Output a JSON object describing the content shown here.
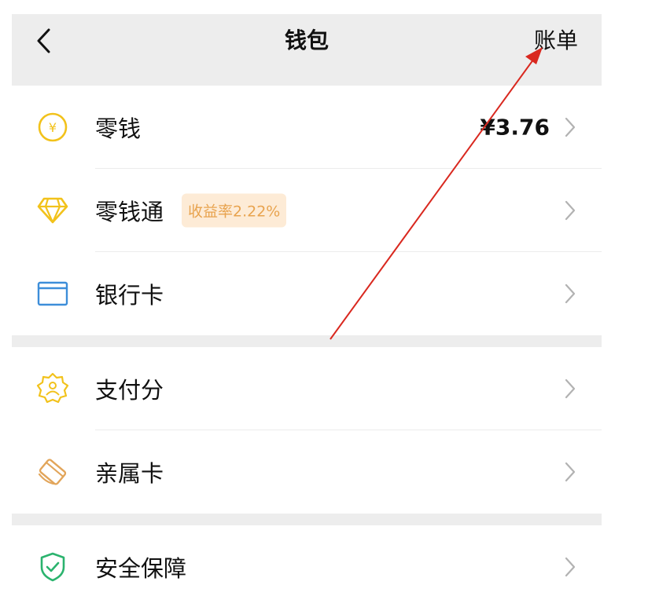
{
  "header": {
    "back_icon": "chevron-left-icon",
    "title": "钱包",
    "bill_label": "账单"
  },
  "groups": [
    {
      "items": [
        {
          "icon": "coin-yuan-icon",
          "label": "零钱",
          "value": "¥3.76"
        },
        {
          "icon": "diamond-icon",
          "label": "零钱通",
          "badge": "收益率2.22%"
        },
        {
          "icon": "bank-card-icon",
          "label": "银行卡"
        }
      ]
    },
    {
      "items": [
        {
          "icon": "pay-score-icon",
          "label": "支付分"
        },
        {
          "icon": "family-card-icon",
          "label": "亲属卡"
        }
      ]
    },
    {
      "items": [
        {
          "icon": "shield-check-icon",
          "label": "安全保障"
        }
      ]
    }
  ],
  "colors": {
    "background": "#ededed",
    "coin": "#f2c21b",
    "diamond": "#f2c21b",
    "card": "#3d8ed9",
    "pay_score": "#f2c21b",
    "family_card": "#e2a55a",
    "shield": "#2bb36e",
    "badge_bg": "#fdebd6",
    "badge_text": "#e8a34e",
    "annotation_arrow": "#d9281f"
  }
}
